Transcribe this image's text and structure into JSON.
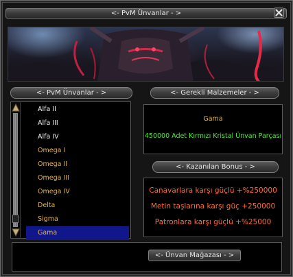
{
  "window": {
    "title": "<- PvM Ünvanlar - >"
  },
  "titles_header": "<- PvM Ünvanlar - >",
  "materials_header": "<- Gerekli Malzemeler - >",
  "titles": [
    {
      "label": "Alfa II",
      "color": "white"
    },
    {
      "label": "Alfa III",
      "color": "white"
    },
    {
      "label": "Alfa IV",
      "color": "white"
    },
    {
      "label": "Omega I",
      "color": "gold"
    },
    {
      "label": "Omega II",
      "color": "gold"
    },
    {
      "label": "Omega III",
      "color": "gold"
    },
    {
      "label": "Omega IV",
      "color": "gold"
    },
    {
      "label": "Delta",
      "color": "gold"
    },
    {
      "label": "Sigma",
      "color": "gold"
    },
    {
      "label": "Gama",
      "color": "gold",
      "selected": true
    }
  ],
  "selected_title": {
    "name": "Gama",
    "requirement": "450000 Adet Kırmızı Kristal Ünvan Parçası"
  },
  "bonus_header": "<- Kazanılan Bonus - >",
  "bonuses": [
    "Canavarlara karşı güçlü +%250000",
    "Metin taşlarına karşı güç +250000",
    "Patronlara karşı güçlü +%25000"
  ],
  "shop_button": "<- Ünvan Mağazası - >",
  "colors": {
    "gold_text": "#e8b43a",
    "green_text": "#54ea3c",
    "orange_text": "#ff6a35",
    "selection_bg": "#10178a"
  },
  "icons": {
    "close": "close-icon",
    "scroll_up": "triangle-up-icon",
    "scroll_down": "triangle-down-icon"
  }
}
